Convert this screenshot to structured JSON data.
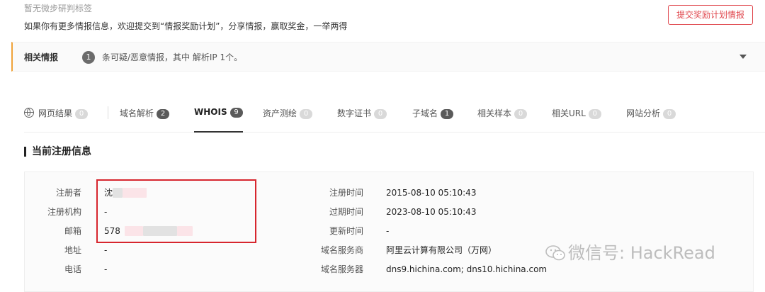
{
  "header": {
    "tag_empty": "暂无微步研判标签",
    "invite_text": "如果你有更多情报信息，欢迎提交到“情报奖励计划”，分享情报，赢取奖金，一举两得",
    "submit_button": "提交奖励计划情报"
  },
  "related": {
    "title": "相关情报",
    "count": "1",
    "text": "条可疑/恶意情报，其中 解析IP 1个。"
  },
  "tabs": [
    {
      "label": "网页结果",
      "count": "0"
    },
    {
      "label": "域名解析",
      "count": "2"
    },
    {
      "label": "WHOIS",
      "count": "9"
    },
    {
      "label": "资产测绘",
      "count": "0"
    },
    {
      "label": "数字证书",
      "count": "0"
    },
    {
      "label": "子域名",
      "count": "1"
    },
    {
      "label": "相关样本",
      "count": "0"
    },
    {
      "label": "相关URL",
      "count": "0"
    },
    {
      "label": "网站分析",
      "count": "0"
    }
  ],
  "section_title": "当前注册信息",
  "registration": {
    "left": [
      {
        "label": "注册者",
        "value": "沈"
      },
      {
        "label": "注册机构",
        "value": "-"
      },
      {
        "label": "邮箱",
        "value": "578"
      },
      {
        "label": "地址",
        "value": "-"
      },
      {
        "label": "电话",
        "value": "-"
      }
    ],
    "right": [
      {
        "label": "注册时间",
        "value": "2015-08-10 05:10:43"
      },
      {
        "label": "过期时间",
        "value": "2023-08-10 05:10:43"
      },
      {
        "label": "更新时间",
        "value": "-"
      },
      {
        "label": "域名服务商",
        "value": "阿里云计算有限公司（万网）"
      },
      {
        "label": "域名服务器",
        "value": "dns9.hichina.com; dns10.hichina.com"
      }
    ]
  },
  "watermark": "微信号: HackRead",
  "colors": {
    "accent_red": "#e0484e",
    "highlight_box": "#d7262e",
    "related_border": "#f0a33a"
  }
}
